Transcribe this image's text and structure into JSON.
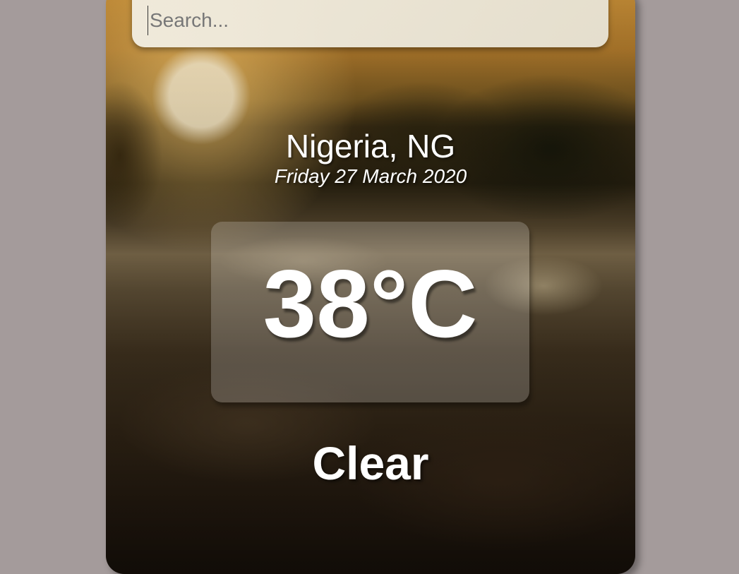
{
  "search": {
    "placeholder": "Search...",
    "value": ""
  },
  "weather": {
    "location": "Nigeria, NG",
    "date": "Friday 27 March 2020",
    "temperature": "38°C",
    "condition": "Clear"
  },
  "colors": {
    "page_background": "#a49b9b",
    "text": "#ffffff",
    "search_background": "#efece0"
  }
}
